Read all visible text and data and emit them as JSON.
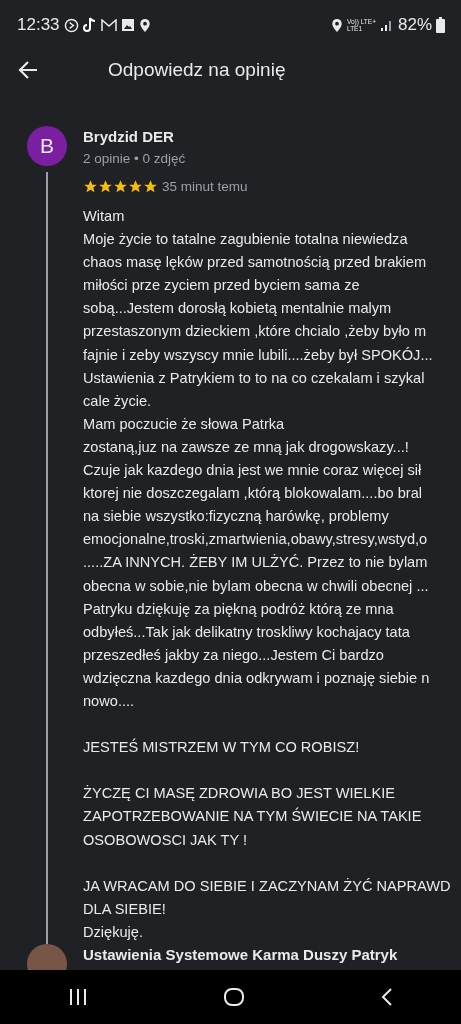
{
  "status_bar": {
    "time": "12:33",
    "network": "Vo)) LTE+",
    "network_2": "LTE1",
    "battery": "82%"
  },
  "header": {
    "title": "Odpowiedz na opinię"
  },
  "review": {
    "avatar_letter": "B",
    "author": "Brydzid DER",
    "meta": "2 opinie • 0 zdjęć",
    "stars": 5,
    "time": "35 minut temu",
    "paragraphs": [
      [
        "Witam",
        "Moje życie to tatalne zagubienie totalna niewiedza",
        "chaos masę lęków przed samotnością przed brakiem",
        "miłości prze zyciem przed byciem sama ze",
        "sobą...Jestem dorosłą kobietą mentalnie malym",
        "przestaszonym dzieckiem ,które chcialo ,żeby było m",
        "fajnie i zeby wszyscy mnie lubili....żeby był SPOKÓJ...",
        "Ustawienia z Patrykiem to to na co czekalam i szykal",
        "cale życie.",
        "Mam poczucie że słowa Patrka",
        "zostaną,juz na zawsze ze mną jak drogowskazy...!",
        "Czuje jak kazdego dnia jest we mnie coraz więcej sił",
        "ktorej nie doszczegalam ,którą blokowalam....bo bral",
        "na siebie wszystko:fizyczną harówkę, problemy",
        "emocjonalne,troski,zmartwienia,obawy,stresy,wstyd,o",
        ".....ZA INNYCH. ŻEBY IM ULŻYĆ. Przez to nie bylam",
        "obecna w sobie,nie bylam obecna w chwili obecnej ...",
        "Patryku dziękuję za piękną podróż którą ze mna",
        "odbyłeś...Tak jak delikatny troskliwy kochajacy tata",
        "przeszedłeś jakby za niego...Jestem Ci bardzo",
        "wdzięczna kazdego dnia odkrywam i poznaję siebie n",
        "nowo...."
      ],
      [
        "JESTEŚ MISTRZEM W TYM CO ROBISZ!"
      ],
      [
        "ŻYCZĘ CI MASĘ ZDROWIA BO JEST WIELKIE",
        "ZAPOTRZEBOWANIE NA TYM ŚWIECIE NA TAKIE",
        "OSOBOWOSCI JAK TY !"
      ],
      [
        "JA WRACAM DO SIEBIE I ZACZYNAM ŻYĆ NAPRAWD",
        "DLA SIEBIE!",
        "Dziękuję."
      ]
    ]
  },
  "reply": {
    "author": "Ustawienia Systemowe Karma Duszy Patryk"
  }
}
